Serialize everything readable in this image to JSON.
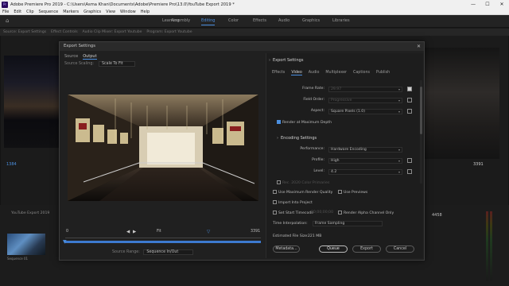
{
  "window": {
    "title": "Adobe Premiere Pro 2019 - C:\\Users\\Asma Khan\\Documents\\Adobe\\Premiere Pro\\13.0\\YouTube Export 2019 *",
    "app_icon": "Pr",
    "controls": [
      "—",
      "☐",
      "✕"
    ]
  },
  "menu": [
    "File",
    "Edit",
    "Clip",
    "Sequence",
    "Markers",
    "Graphics",
    "View",
    "Window",
    "Help"
  ],
  "workspaces": {
    "items": [
      "Learning",
      "Assembly",
      "Editing",
      "Color",
      "Effects",
      "Audio",
      "Graphics",
      "Libraries"
    ],
    "active": "Editing"
  },
  "background": {
    "left_tabs": [
      "Source: Export Settings",
      "Effect Controls",
      "Audio Clip Mixer: Export Youtube",
      "Program: Export Youtube"
    ],
    "left_timecode": "1384",
    "right_timecode": "3391",
    "project_label": "YouTube Export 2019",
    "thumb_caption": "Sequence 01",
    "right_number": "4458",
    "left_numbers": [
      "1384"
    ]
  },
  "dialog": {
    "title": "Export Settings",
    "close": "✕",
    "left_tabs": [
      "Source",
      "Output"
    ],
    "left_active": "Output",
    "source_scaling_label": "Source Scaling:",
    "source_scaling_value": "Scale To Fit",
    "timeline": {
      "start": "0",
      "end": "3391",
      "fit": "Fit",
      "source_range_label": "Source Range:",
      "source_range_value": "Sequence In/Out"
    },
    "right": {
      "export_settings_header": "Export Settings",
      "tabs": [
        "Effects",
        "Video",
        "Audio",
        "Multiplexer",
        "Captions",
        "Publish"
      ],
      "active_tab": "Video",
      "rows": [
        {
          "label": "Frame Rate:",
          "value": "29.97",
          "dim": true,
          "checkbox": true,
          "checked": true
        },
        {
          "label": "Field Order:",
          "value": "Progressive",
          "dim": true,
          "checkbox": true,
          "checked": false
        },
        {
          "label": "Aspect:",
          "value": "Square Pixels (1.0)",
          "dim": false,
          "checkbox": true,
          "checked": false
        }
      ],
      "render_max_depth": "Render at Maximum Depth",
      "encoding_header": "Encoding Settings",
      "encoding_rows": [
        {
          "label": "Performance:",
          "value": "Hardware Encoding",
          "dim": false,
          "checkbox": false
        },
        {
          "label": "Profile:",
          "value": "High",
          "dim": false,
          "checkbox": true,
          "checked": false
        },
        {
          "label": "Level:",
          "value": "4.2",
          "dim": false,
          "checkbox": true,
          "checked": false
        }
      ],
      "rec2020": "Rec. 2020 Color Primaries",
      "options": {
        "use_max_quality": "Use Maximum Render Quality",
        "use_previews": "Use Previews",
        "import_into_project": "Import Into Project",
        "set_start_timecode": "Set Start Timecode",
        "start_timecode_value": "00;00;00;00",
        "render_alpha": "Render Alpha Channel Only",
        "time_interp_label": "Time Interpolation:",
        "time_interp_value": "Frame Sampling",
        "file_size_label": "Estimated File Size:",
        "file_size_value": "221 MB"
      },
      "buttons": {
        "metadata": "Metadata...",
        "queue": "Queue",
        "export": "Export",
        "cancel": "Cancel"
      }
    }
  }
}
